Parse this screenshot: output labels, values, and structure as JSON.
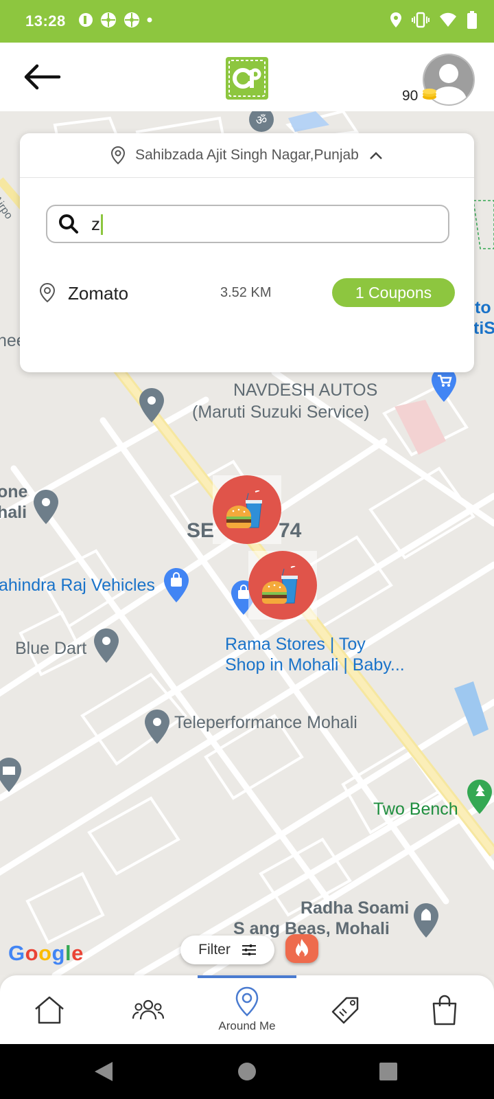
{
  "status_bar": {
    "time": "13:28"
  },
  "header": {
    "coins": "90"
  },
  "location_panel": {
    "location": "Sahibzada Ajit Singh Nagar,Punjab",
    "search_value": "z",
    "results": [
      {
        "name": "Zomato",
        "distance": "3.52 KM",
        "coupons_label": "1 Coupons"
      }
    ]
  },
  "map": {
    "labels": {
      "airport": "Airpo",
      "left_fragment": "hee",
      "navdesh_line1": "NAVDESH AUTOS",
      "navdesh_line2": "(Maruti Suzuki Service)",
      "right_fragment_1": "to",
      "right_fragment_2": "tiS",
      "one": "one",
      "hali": "hali",
      "sector_left": "SE",
      "sector_right": "74",
      "mahindra": "ahindra Raj Vehicles",
      "blue_dart": "Blue Dart",
      "rama_line1": "Rama Stores | Toy",
      "rama_line2": "Shop in Mohali | Baby...",
      "teleperformance": "Teleperformance Mohali",
      "two_bench": "Two Bench",
      "radha_line1": "Radha Soami",
      "radha_line2": "S   ang Beas, Mohali"
    },
    "google": "Google",
    "filter_label": "Filter"
  },
  "bottom_nav": {
    "items": [
      {
        "icon": "home-icon",
        "label": ""
      },
      {
        "icon": "people-icon",
        "label": ""
      },
      {
        "icon": "location-pin-icon",
        "label": "Around Me"
      },
      {
        "icon": "tag-icon",
        "label": ""
      },
      {
        "icon": "shopping-bag-icon",
        "label": ""
      }
    ]
  },
  "colors": {
    "brand_green": "#8dc63f",
    "marker_red": "#e0544a",
    "active_blue": "#4a7bd0"
  }
}
